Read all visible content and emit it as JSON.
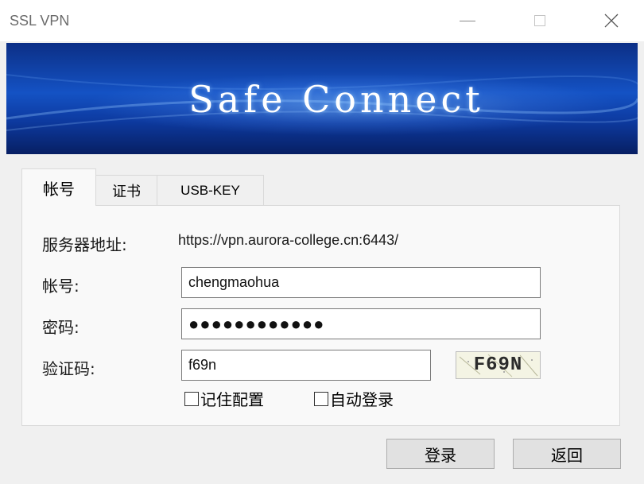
{
  "window": {
    "title": "SSL VPN"
  },
  "banner": {
    "title": "Safe Connect"
  },
  "tabs": [
    {
      "label": "帐号",
      "active": true
    },
    {
      "label": "证书",
      "active": false
    },
    {
      "label": "USB-KEY",
      "active": false
    }
  ],
  "form": {
    "server_label": "服务器地址:",
    "server_value": "https://vpn.aurora-college.cn:6443/",
    "account_label": "帐号:",
    "account_value": "chengmaohua",
    "password_label": "密码:",
    "password_value": "●●●●●●●●●●●●",
    "captcha_label": "验证码:",
    "captcha_value": "f69n",
    "captcha_image_text": "F69N",
    "remember_label": "记住配置",
    "remember_checked": false,
    "autologin_label": "自动登录",
    "autologin_checked": false
  },
  "buttons": {
    "login": "登录",
    "back": "返回"
  },
  "colors": {
    "banner_dark": "#0c2f86",
    "banner_light": "#1452c4",
    "frame": "#f0f0f0",
    "panel": "#f9f9f9"
  }
}
